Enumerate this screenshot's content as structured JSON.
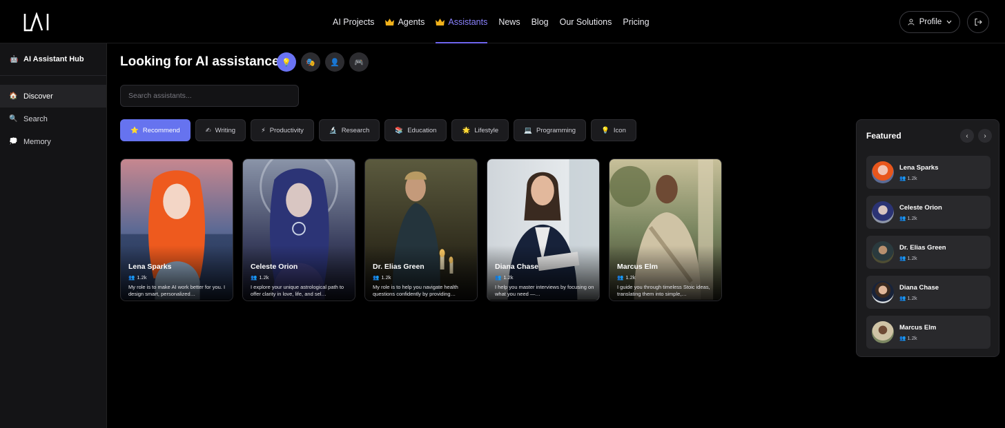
{
  "header": {
    "logo_text": "LAI",
    "nav": [
      {
        "label": "AI Projects",
        "icon": ""
      },
      {
        "label": "Agents",
        "icon": "crown-icon"
      },
      {
        "label": "Assistants",
        "icon": "crown-icon",
        "active": true
      },
      {
        "label": "News",
        "icon": ""
      },
      {
        "label": "Blog",
        "icon": ""
      },
      {
        "label": "Our Solutions",
        "icon": ""
      },
      {
        "label": "Pricing",
        "icon": ""
      }
    ],
    "profile_label": "Profile"
  },
  "sidebar": {
    "title": "AI Assistant Hub",
    "items": [
      {
        "label": "Discover",
        "icon": "home-icon",
        "active": true
      },
      {
        "label": "Search",
        "icon": "magnifier-icon"
      },
      {
        "label": "Memory",
        "icon": "speech-bubble-icon"
      }
    ]
  },
  "main": {
    "headline": "Looking for AI assistance?",
    "search_placeholder": "Search assistants...",
    "categories": [
      {
        "label": "Recommend",
        "icon": "⭐",
        "active": true
      },
      {
        "label": "Writing",
        "icon": "✍"
      },
      {
        "label": "Productivity",
        "icon": "⚡"
      },
      {
        "label": "Research",
        "icon": "🔬"
      },
      {
        "label": "Education",
        "icon": "📚"
      },
      {
        "label": "Lifestyle",
        "icon": "🌟"
      },
      {
        "label": "Programming",
        "icon": "💻"
      },
      {
        "label": "Icon",
        "icon": "💡"
      }
    ],
    "assistants": [
      {
        "name": "Lena Sparks",
        "count": "1.2k",
        "desc": "My role is to make AI work better for you. I design smart, personalized…"
      },
      {
        "name": "Celeste Orion",
        "count": "1.2k",
        "desc": "I explore your unique astrological path to offer clarity in love, life, and sel…"
      },
      {
        "name": "Dr. Elias Green",
        "count": "1.2k",
        "desc": "My role is to help you navigate health questions confidently by providing…"
      },
      {
        "name": "Diana Chase",
        "count": "1.2k",
        "desc": "I help you master interviews by focusing on what you need —…"
      },
      {
        "name": "Marcus Elm",
        "count": "1.2k",
        "desc": "I guide you through timeless Stoic ideas, translating them into simple,…"
      }
    ]
  },
  "featured": {
    "title": "Featured",
    "items": [
      {
        "name": "Lena Sparks",
        "count": "1.2k"
      },
      {
        "name": "Celeste Orion",
        "count": "1.2k"
      },
      {
        "name": "Dr. Elias Green",
        "count": "1.2k"
      },
      {
        "name": "Diana Chase",
        "count": "1.2k"
      },
      {
        "name": "Marcus Elm",
        "count": "1.2k"
      }
    ]
  },
  "colors": {
    "accent": "#6673ef",
    "accent_text": "#8b83ff",
    "background": "#000000",
    "sidebar": "#141416"
  }
}
